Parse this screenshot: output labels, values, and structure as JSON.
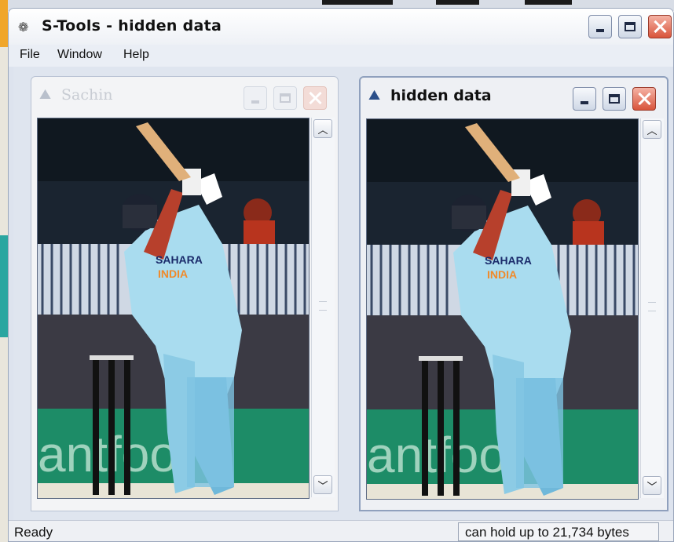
{
  "window": {
    "title": "S-Tools - hidden data",
    "app_icon": "s-tools-icon"
  },
  "menu": [
    "File",
    "Window",
    "Help"
  ],
  "children": [
    {
      "title": "Sachin",
      "state": "inactive",
      "icon": "picture-document-icon",
      "image_desc": "Cricket batsman in light blue India jersey mid-swing, crowd and railings behind"
    },
    {
      "title": "hidden data",
      "state": "active",
      "icon": "picture-document-icon",
      "image_desc": "Same cricket batsman image containing hidden data"
    }
  ],
  "status": {
    "left": "Ready",
    "right": "can hold up to 21,734 bytes"
  },
  "colors": {
    "title_bar": "#f2f5fa",
    "close_red": "#d9543b",
    "jersey": "#a9dcef",
    "field_green": "#1d8c67"
  }
}
